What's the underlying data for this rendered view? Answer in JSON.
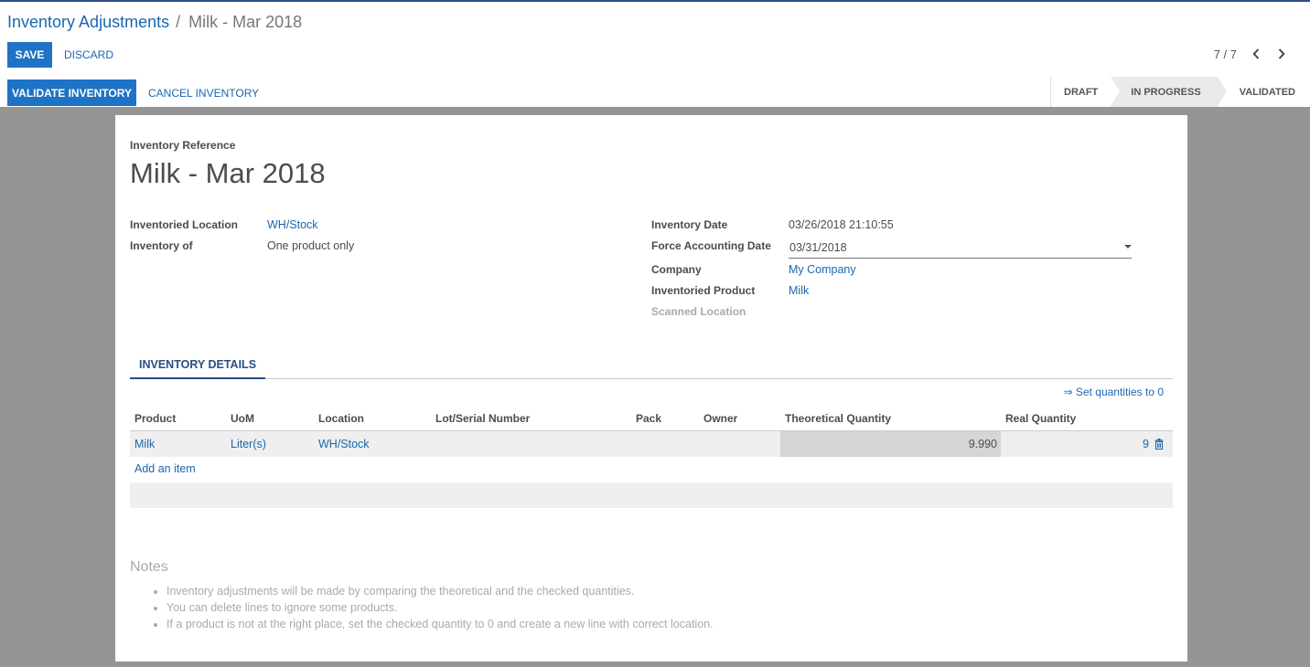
{
  "breadcrumb": {
    "parent": "Inventory Adjustments",
    "separator": "/",
    "current": "Milk - Mar 2018"
  },
  "toolbar": {
    "save_label": "SAVE",
    "discard_label": "DISCARD",
    "validate_label": "VALIDATE INVENTORY",
    "cancel_label": "CANCEL INVENTORY"
  },
  "pager": {
    "value": "7 / 7"
  },
  "statusbar": {
    "stages": [
      "DRAFT",
      "IN PROGRESS",
      "VALIDATED"
    ],
    "active": "IN PROGRESS"
  },
  "form": {
    "reference_label": "Inventory Reference",
    "reference_value": "Milk - Mar 2018",
    "left": {
      "location_label": "Inventoried Location",
      "location_value": "WH/Stock",
      "inventory_of_label": "Inventory of",
      "inventory_of_value": "One product only"
    },
    "right": {
      "date_label": "Inventory Date",
      "date_value": "03/26/2018 21:10:55",
      "force_date_label": "Force Accounting Date",
      "force_date_value": "03/31/2018",
      "company_label": "Company",
      "company_value": "My Company",
      "product_label": "Inventoried Product",
      "product_value": "Milk",
      "scanned_label": "Scanned Location"
    }
  },
  "tabs": {
    "details_label": "INVENTORY DETAILS"
  },
  "lines": {
    "set_quantities_label": "⇒ Set quantities to 0",
    "columns": [
      "Product",
      "UoM",
      "Location",
      "Lot/Serial Number",
      "Pack",
      "Owner",
      "Theoretical Quantity",
      "Real Quantity"
    ],
    "rows": [
      {
        "product": "Milk",
        "uom": "Liter(s)",
        "location": "WH/Stock",
        "lot": "",
        "pack": "",
        "owner": "",
        "theoretical": "9.990",
        "real": "9"
      }
    ],
    "add_item_label": "Add an item"
  },
  "notes": {
    "label": "Notes",
    "items": [
      "Inventory adjustments will be made by comparing the theoretical and the checked quantities.",
      "You can delete lines to ignore some products.",
      "If a product is not at the right place, set the checked quantity to 0 and create a new line with correct location."
    ]
  },
  "colors": {
    "primary": "#1f73c6",
    "link": "#1a67b0",
    "tab_active": "#2b4e83",
    "background": "#959595"
  },
  "icons": {
    "pager_prev": "chevron-left-icon",
    "pager_next": "chevron-right-icon",
    "delete_line": "trash-icon",
    "date_dropdown": "caret-down-icon"
  }
}
